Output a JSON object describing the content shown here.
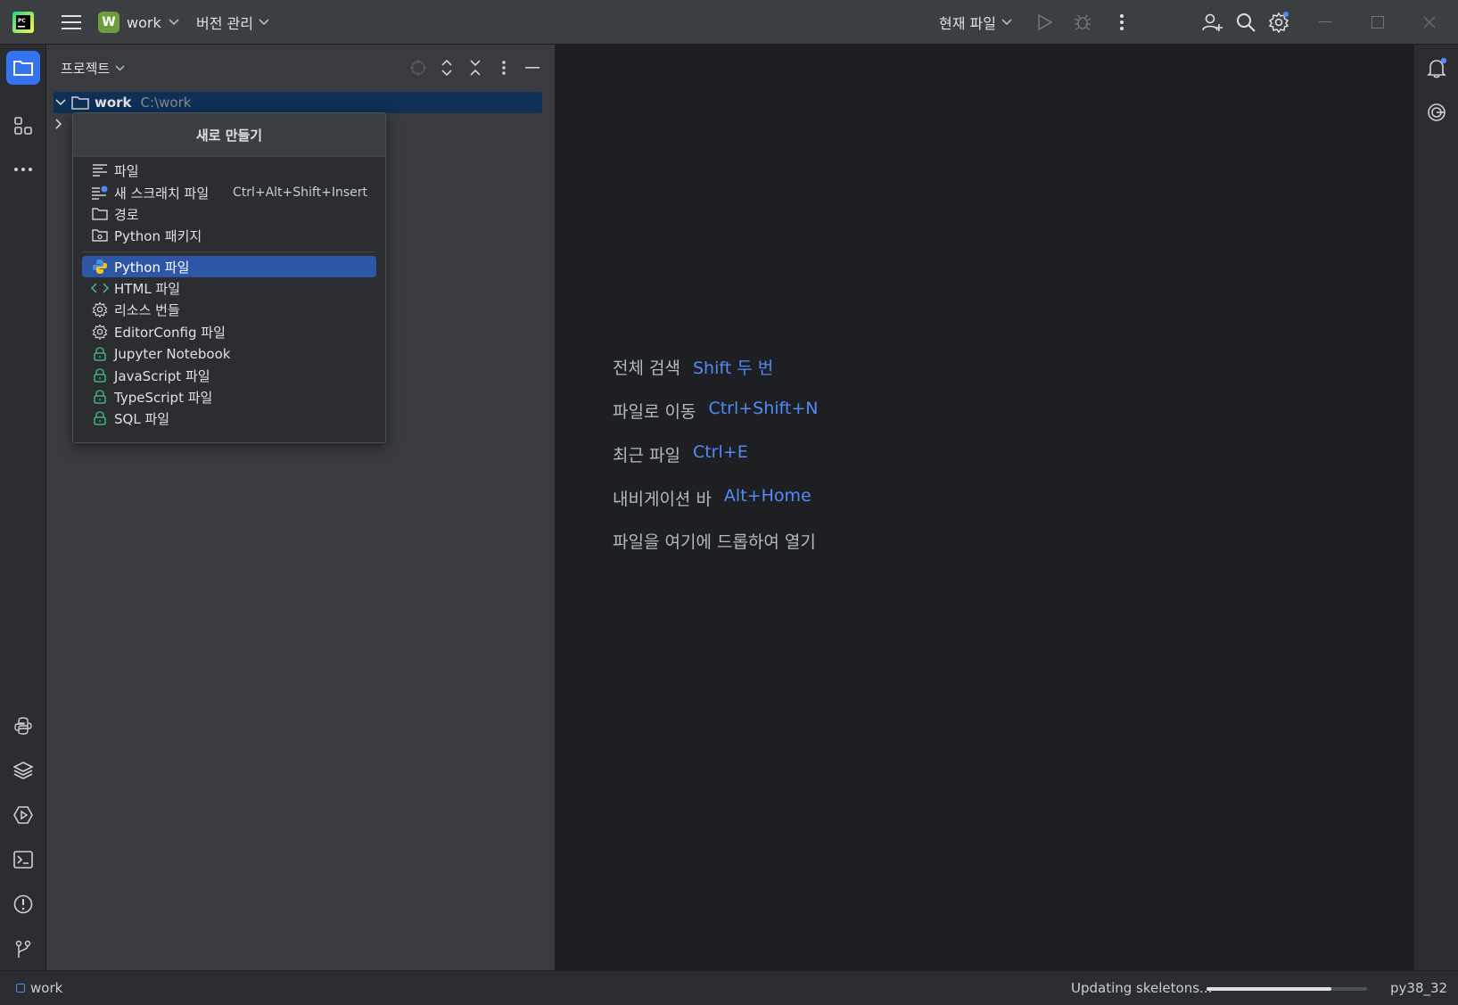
{
  "titlebar": {
    "project_badge": "W",
    "project_name": "work",
    "vcs_label": "버전 관리",
    "run_config_label": "현재 파일"
  },
  "project_panel": {
    "title": "프로젝트",
    "root": {
      "name": "work",
      "path": "C:\\work"
    }
  },
  "popup": {
    "title": "새로 만들기",
    "group1": [
      {
        "label": "파일",
        "shortcut": ""
      },
      {
        "label": "새 스크래치 파일",
        "shortcut": "Ctrl+Alt+Shift+Insert"
      },
      {
        "label": "경로",
        "shortcut": ""
      },
      {
        "label": "Python 패키지",
        "shortcut": ""
      }
    ],
    "group2": [
      {
        "label": "Python 파일"
      },
      {
        "label": "HTML 파일"
      },
      {
        "label": "리소스 번들"
      },
      {
        "label": "EditorConfig 파일"
      },
      {
        "label": "Jupyter Notebook"
      },
      {
        "label": "JavaScript 파일"
      },
      {
        "label": "TypeScript 파일"
      },
      {
        "label": "SQL 파일"
      }
    ]
  },
  "editor_hints": [
    {
      "label": "전체 검색",
      "key": "Shift 두 번"
    },
    {
      "label": "파일로 이동",
      "key": "Ctrl+Shift+N"
    },
    {
      "label": "최근 파일",
      "key": "Ctrl+E"
    },
    {
      "label": "내비게이션 바",
      "key": "Alt+Home"
    },
    {
      "label": "파일을 여기에 드롭하여 열기",
      "key": ""
    }
  ],
  "statusbar": {
    "breadcrumb": "work",
    "progress_text": "Updating skeletons...",
    "progress_fraction": 0.78,
    "interpreter": "py38_32"
  },
  "colors": {
    "accent": "#3574f0",
    "key_hint": "#548af7",
    "selection": "#2e56a6",
    "tree_selection": "#0e3055",
    "project_badge": "#6f9c3e",
    "locked_icon": "#3fb37f"
  }
}
